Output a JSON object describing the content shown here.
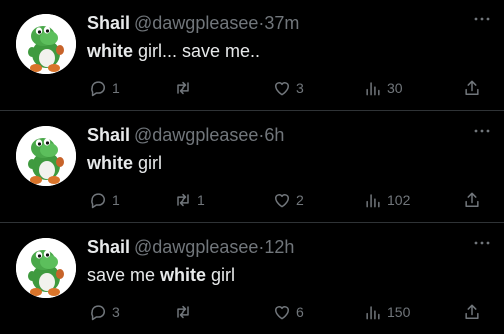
{
  "tweets": [
    {
      "name": "Shail",
      "handle": "@dawgpleasee",
      "separator": "·",
      "time": "37m",
      "text_parts": [
        {
          "text": "white",
          "bold": true
        },
        {
          "text": " girl... save me..",
          "bold": false
        }
      ],
      "replies": "1",
      "retweets": "",
      "likes": "3",
      "views": "30"
    },
    {
      "name": "Shail",
      "handle": "@dawgpleasee",
      "separator": "·",
      "time": "6h",
      "text_parts": [
        {
          "text": "white",
          "bold": true
        },
        {
          "text": " girl",
          "bold": false
        }
      ],
      "replies": "1",
      "retweets": "1",
      "likes": "2",
      "views": "102"
    },
    {
      "name": "Shail",
      "handle": "@dawgpleasee",
      "separator": "·",
      "time": "12h",
      "text_parts": [
        {
          "text": "save me ",
          "bold": false
        },
        {
          "text": "white",
          "bold": true
        },
        {
          "text": " girl",
          "bold": false
        }
      ],
      "replies": "3",
      "retweets": "",
      "likes": "6",
      "views": "150"
    }
  ],
  "icons": {
    "avatar": "green-dinosaur-plush-avatar",
    "more": "more-horizontal-icon",
    "reply": "reply-bubble-icon",
    "retweet": "retweet-arrows-icon",
    "like": "heart-icon",
    "views": "analytics-bars-icon",
    "share": "share-upload-icon"
  },
  "colors": {
    "background": "#000000",
    "primary_text": "#e7e9ea",
    "secondary_text": "#71767b",
    "divider": "#2f3336"
  }
}
